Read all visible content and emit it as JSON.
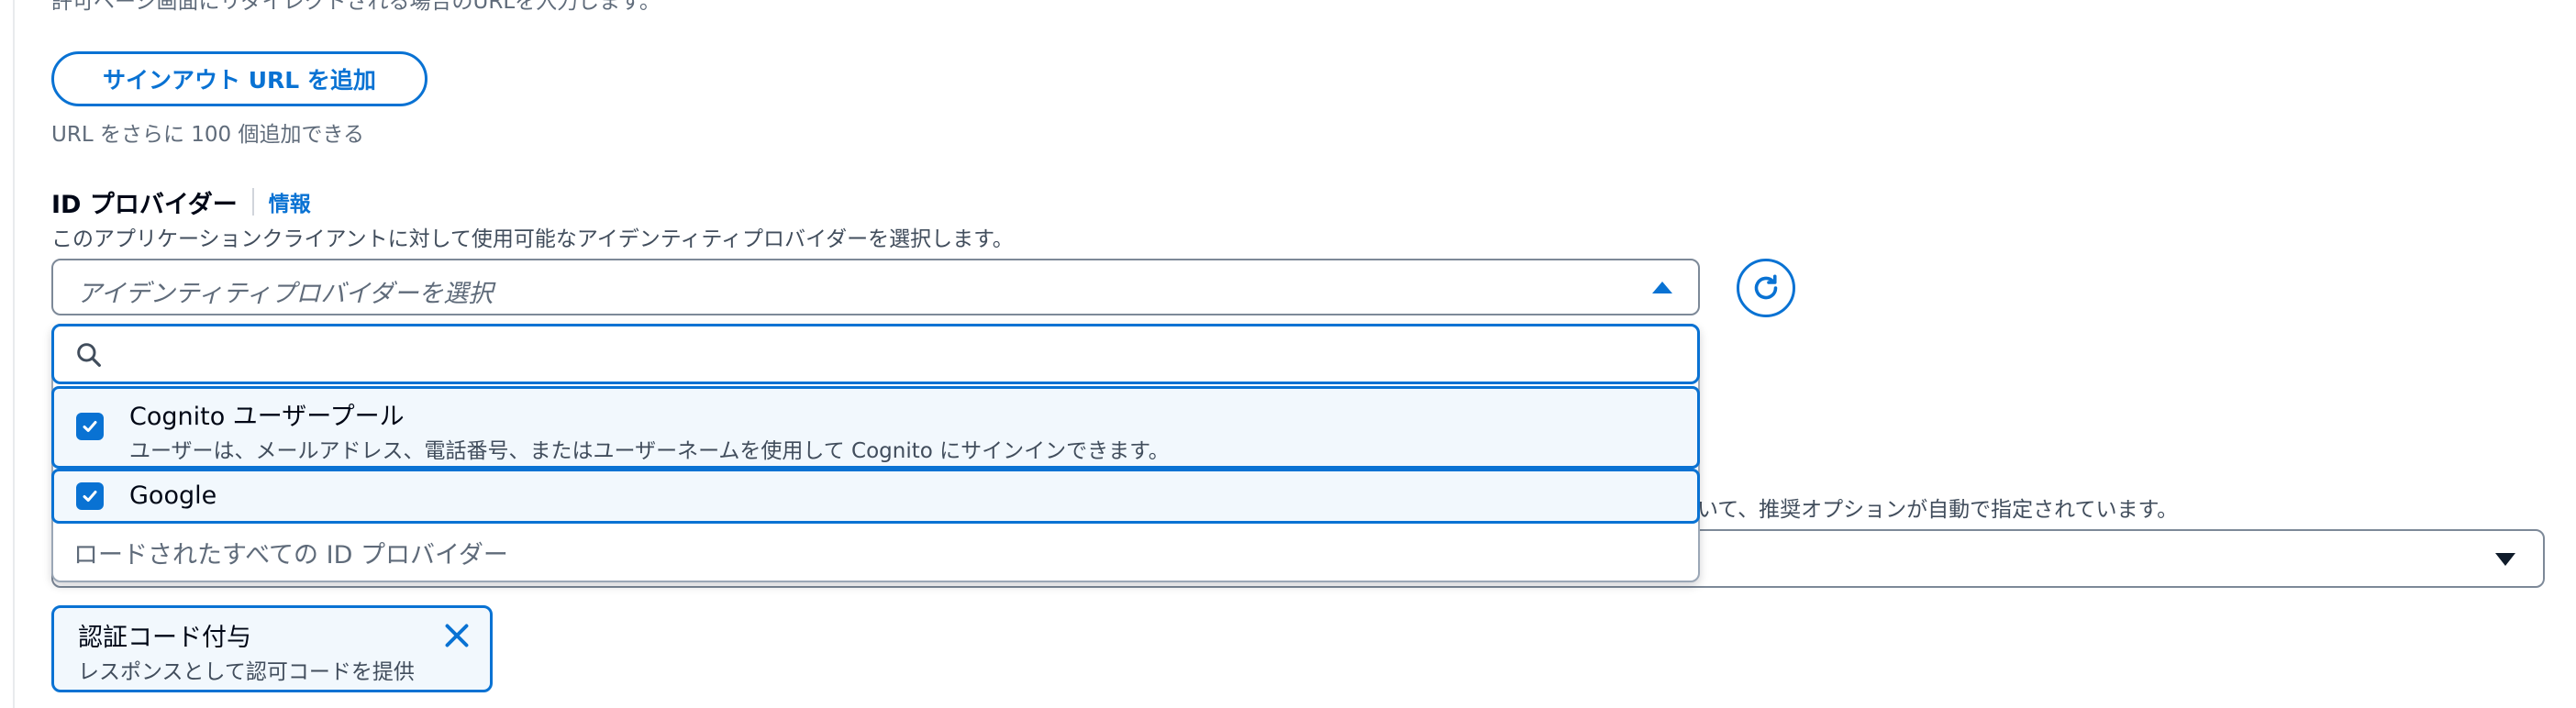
{
  "top_partial_text": "許可ページ画面にリダイレクトされる場合のURLを入力します。",
  "signout": {
    "add_button_label": "サインアウト URL を追加",
    "remaining_hint": "URL をさらに 100 個追加できる"
  },
  "identity_providers": {
    "label": "ID プロバイダー",
    "info_link": "情報",
    "description": "このアプリケーションクライアントに対して使用可能なアイデンティティプロバイダーを選択します。",
    "select_placeholder": "アイデンティティプロバイダーを選択",
    "search_placeholder": "",
    "options": [
      {
        "title": "Cognito ユーザープール",
        "description": "ユーザーは、メールアドレス、電話番号、またはユーザーネームを使用して Cognito にサインインできます。",
        "checked": true
      },
      {
        "title": "Google",
        "description": "",
        "checked": true
      }
    ],
    "footer_text": "ロードされたすべての ID プロバイダー"
  },
  "background": {
    "partial_text": "いて、推奨オプションが自動で指定されています。"
  },
  "grant_type_token": {
    "title": "認証コード付与",
    "description": "レスポンスとして認可コードを提供"
  },
  "colors": {
    "accent": "#0972d3",
    "selected_bg": "#f2f8fd",
    "text_primary": "#000716",
    "text_secondary": "#5f6b7a"
  },
  "icons": {
    "search": "search-icon",
    "refresh": "refresh-icon",
    "close": "close-icon",
    "checkbox": "checkmark-icon"
  }
}
